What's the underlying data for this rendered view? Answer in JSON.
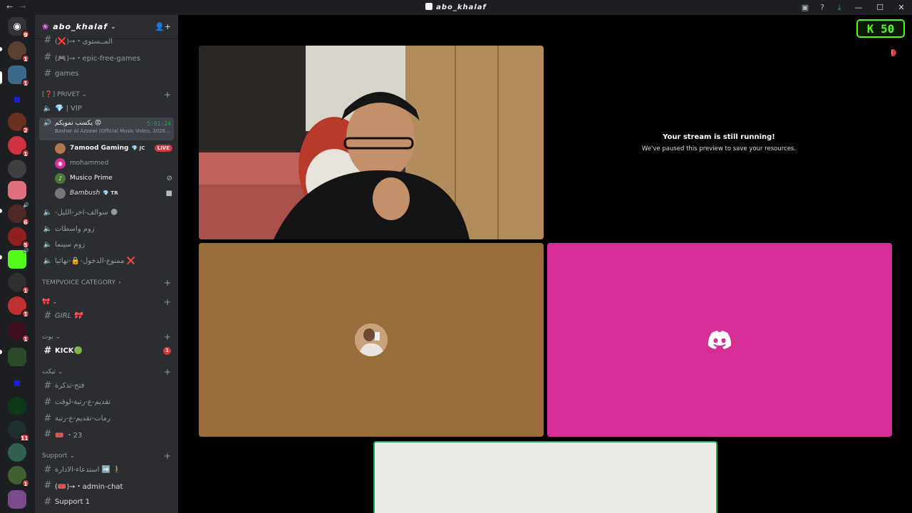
{
  "titlebar": {
    "back": "←",
    "forward": "→",
    "title": "abo_khalaf",
    "inbox_icon": "inbox-icon",
    "help_icon": "help-icon",
    "download_icon": "download-icon",
    "minimize": "—",
    "maximize": "☐",
    "close": "✕"
  },
  "guilds": {
    "home_badge": "9",
    "items": [
      {
        "badge": "1",
        "color": "#5a4030"
      },
      {
        "badge": "1",
        "color": "#3a6a8a"
      },
      {
        "badge": "",
        "color": "#1f1fd8"
      },
      {
        "badge": "2",
        "color": "#6a3020"
      },
      {
        "badge": "1",
        "color": "#d03040"
      },
      {
        "badge": "",
        "color": "#404040"
      },
      {
        "badge": "",
        "color": "#e07080"
      },
      {
        "badge": "6",
        "color": "#502828"
      },
      {
        "badge": "5",
        "color": "#902020"
      },
      {
        "badge": "",
        "color": "#53fc18"
      },
      {
        "badge": "1",
        "color": "#303030"
      },
      {
        "badge": "1",
        "color": "#c03030"
      },
      {
        "badge": "1",
        "color": "#401020"
      },
      {
        "badge": "",
        "color": "#2a4a2a"
      },
      {
        "badge": "",
        "color": "#1f1fd8"
      },
      {
        "badge": "",
        "color": "#0a3a1a"
      },
      {
        "badge": "11",
        "color": "#203030"
      },
      {
        "badge": "",
        "color": "#306050"
      },
      {
        "badge": "1",
        "color": "#406030"
      },
      {
        "badge": "",
        "color": "#7a4a8a"
      }
    ]
  },
  "server": {
    "name": "abo_khalaf",
    "invite_icon": "add-member-icon"
  },
  "channels": {
    "c0": "(❌)➙・المــستوى",
    "c1": "(🎮)➙・epic-free-games",
    "c2": "games",
    "cat_privet": "[❓] PRIVET",
    "vip": "💎 | VIP",
    "active_vc": "يكسب نمويكم 😡",
    "active_time": "5:01:24",
    "active_activity": "Bashar Al Azzawi (Official Music Video, 2026...",
    "users": [
      {
        "name": "7amood Gaming",
        "tag": "💎 JC",
        "live": "LIVE"
      },
      {
        "name": "mohammed"
      },
      {
        "name": "Musico Prime"
      },
      {
        "name": "Bambush",
        "tag": "💎 TR"
      }
    ],
    "v1": "-سوالف-اخر-الليل 🌑",
    "v2": "زوم واسطات",
    "v3": "زوم سينما",
    "v4": "ممنوع-الدخول-🔒-نهائيا ❌",
    "cat_temp": "TEMPVOICE CATEGORY",
    "cat_heart": "🎀",
    "girl": "GIRL 🎀",
    "cat_bot": "بوت",
    "kick": "KICK🟢",
    "kick_badge": "1",
    "cat_tickets": "تيكت",
    "t1": "فتح-تذكرة",
    "t2": "تقديم-ع-رتبة-لوقت",
    "t3": "رمات-تقديم-ع-رتبة",
    "t4": "🎟️ ・23",
    "cat_support": "Support",
    "s1": "استدعاء-الادارة ➡️ 🚶",
    "s2": "(🎟️)➙・admin-chat",
    "s3": "Support 1"
  },
  "stage": {
    "kick_label": "K 50",
    "live": "LIVE",
    "paused_title": "Your stream is still running!",
    "paused_sub": "We've paused this preview to save your resources.",
    "discord_icon": "discord-logo-icon",
    "colors": {
      "brown": "#9a6e3b",
      "pink": "#d62d96",
      "green": "#23a55a",
      "red": "#da373c"
    }
  }
}
